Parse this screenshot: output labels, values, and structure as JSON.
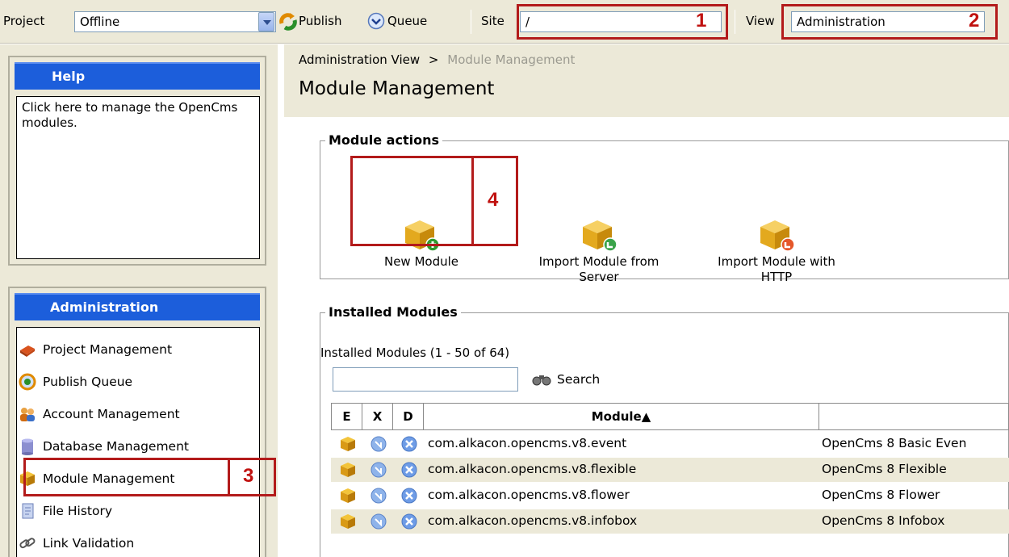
{
  "toolbar": {
    "project_label": "Project",
    "project_value": "Offline",
    "publish_label": "Publish",
    "queue_label": "Queue",
    "site_label": "Site",
    "site_value": "/",
    "view_label": "View",
    "view_value": "Administration"
  },
  "callouts": [
    "1",
    "2",
    "3",
    "4"
  ],
  "help": {
    "title": "Help",
    "text": "Click here to manage the OpenCms modules."
  },
  "admin": {
    "title": "Administration",
    "items": [
      {
        "label": "Project Management",
        "icon": "project-icon"
      },
      {
        "label": "Publish Queue",
        "icon": "publish-queue-icon"
      },
      {
        "label": "Account Management",
        "icon": "account-icon"
      },
      {
        "label": "Database Management",
        "icon": "database-icon"
      },
      {
        "label": "Module Management",
        "icon": "module-icon"
      },
      {
        "label": "File History",
        "icon": "file-history-icon"
      },
      {
        "label": "Link Validation",
        "icon": "link-icon"
      }
    ]
  },
  "breadcrumb": {
    "parent": "Administration View",
    "separator": ">",
    "current": "Module Management"
  },
  "page_title": "Module Management",
  "module_actions": {
    "legend": "Module actions",
    "actions": [
      {
        "line1": "New Module",
        "line2": ""
      },
      {
        "line1": "Import Module from",
        "line2": "Server"
      },
      {
        "line1": "Import Module with",
        "line2": "HTTP"
      }
    ]
  },
  "installed": {
    "legend": "Installed Modules",
    "count_text": "Installed Modules (1 - 50 of 64)",
    "search_label": "Search",
    "columns": [
      "E",
      "X",
      "D",
      "Module▲"
    ],
    "rows": [
      {
        "module": "com.alkacon.opencms.v8.event",
        "nice": "OpenCms 8 Basic Even"
      },
      {
        "module": "com.alkacon.opencms.v8.flexible",
        "nice": "OpenCms 8 Flexible"
      },
      {
        "module": "com.alkacon.opencms.v8.flower",
        "nice": "OpenCms 8 Flower"
      },
      {
        "module": "com.alkacon.opencms.v8.infobox",
        "nice": "OpenCms 8 Infobox"
      }
    ]
  },
  "colors": {
    "panel_header": "#1c5edb",
    "callout": "#b31b1b",
    "chrome": "#ece9d8"
  }
}
